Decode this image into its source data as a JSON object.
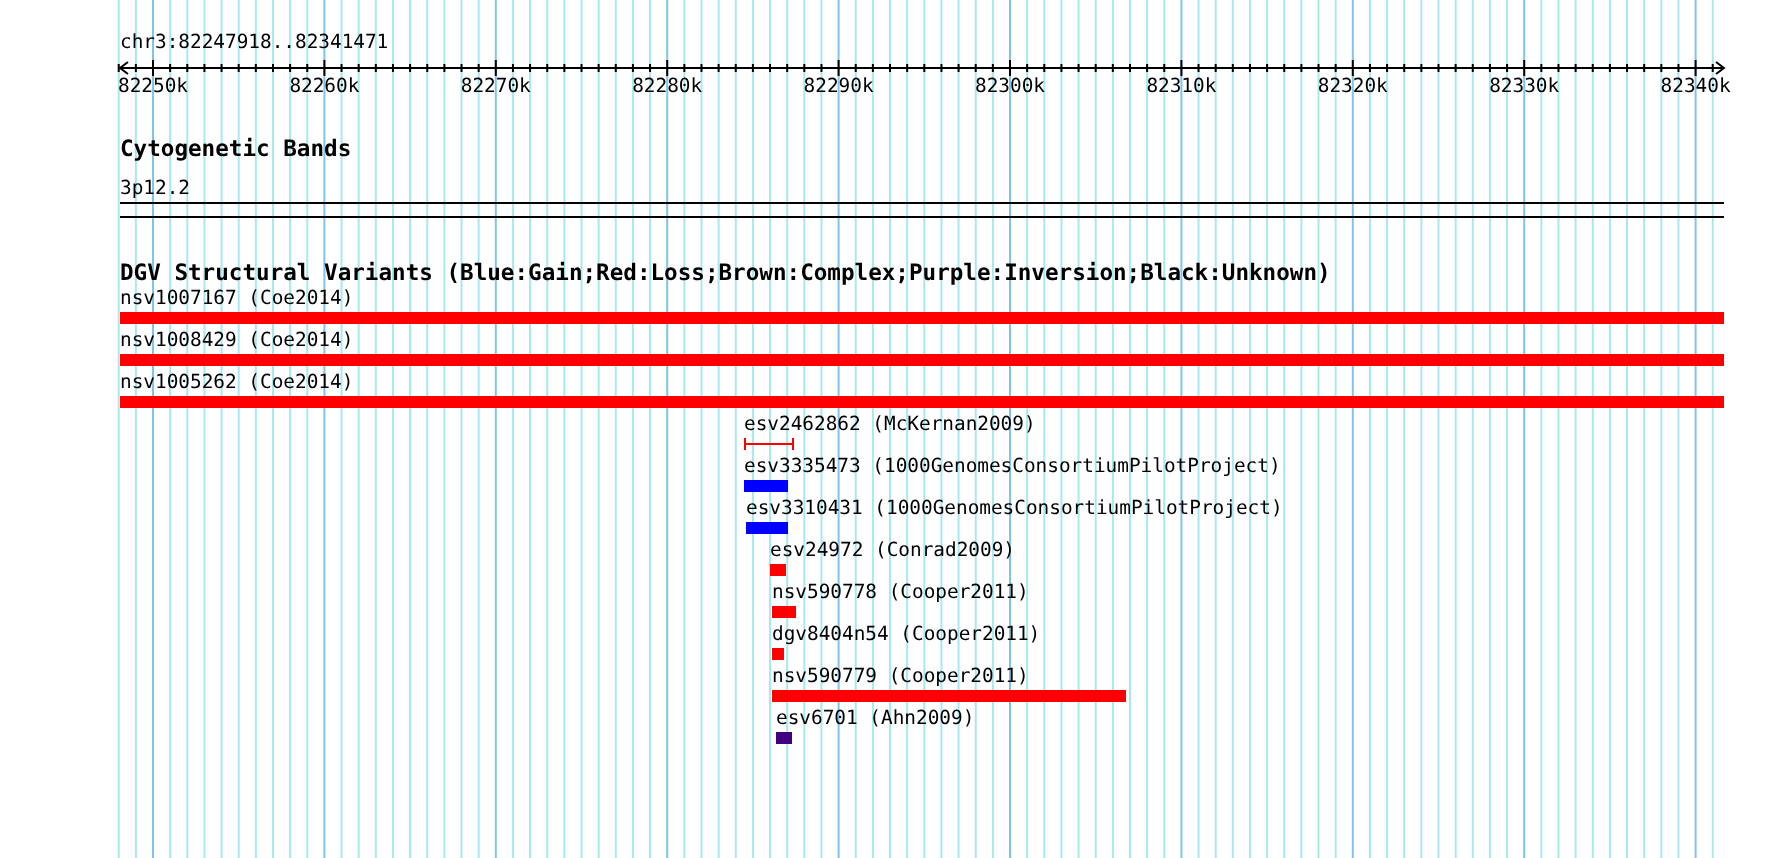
{
  "ruler": {
    "title": "chr3:82247918..82341471",
    "ticks": [
      "82250k",
      "82260k",
      "82270k",
      "82280k",
      "82290k",
      "82300k",
      "82310k",
      "82320k",
      "82330k",
      "82340k"
    ]
  },
  "cytogenetic_bands": {
    "title": "Cytogenetic Bands",
    "band": "3p12.2"
  },
  "dgv_track": {
    "title": "DGV Structural Variants (Blue:Gain;Red:Loss;Brown:Complex;Purple:Inversion;Black:Unknown)",
    "features": [
      {
        "label": "nsv1007167 (Coe2014)",
        "kind": "bar",
        "color": "#ff0000"
      },
      {
        "label": "nsv1008429 (Coe2014)",
        "kind": "bar",
        "color": "#ff0000"
      },
      {
        "label": "nsv1005262 (Coe2014)",
        "kind": "bar",
        "color": "#ff0000"
      },
      {
        "label": "esv2462862 (McKernan2009)",
        "kind": "interval",
        "color": "#ff0000"
      },
      {
        "label": "esv3335473 (1000GenomesConsortiumPilotProject)",
        "kind": "bar",
        "color": "#0000ff"
      },
      {
        "label": "esv3310431 (1000GenomesConsortiumPilotProject)",
        "kind": "bar",
        "color": "#0000ff"
      },
      {
        "label": "esv24972 (Conrad2009)",
        "kind": "bar",
        "color": "#ff0000"
      },
      {
        "label": "nsv590778 (Cooper2011)",
        "kind": "bar",
        "color": "#ff0000"
      },
      {
        "label": "dgv8404n54 (Cooper2011)",
        "kind": "bar",
        "color": "#ff0000"
      },
      {
        "label": "nsv590779 (Cooper2011)",
        "kind": "bar",
        "color": "#ff0000"
      },
      {
        "label": "esv6701 (Ahn2009)",
        "kind": "bar",
        "color": "#400080"
      }
    ]
  }
}
